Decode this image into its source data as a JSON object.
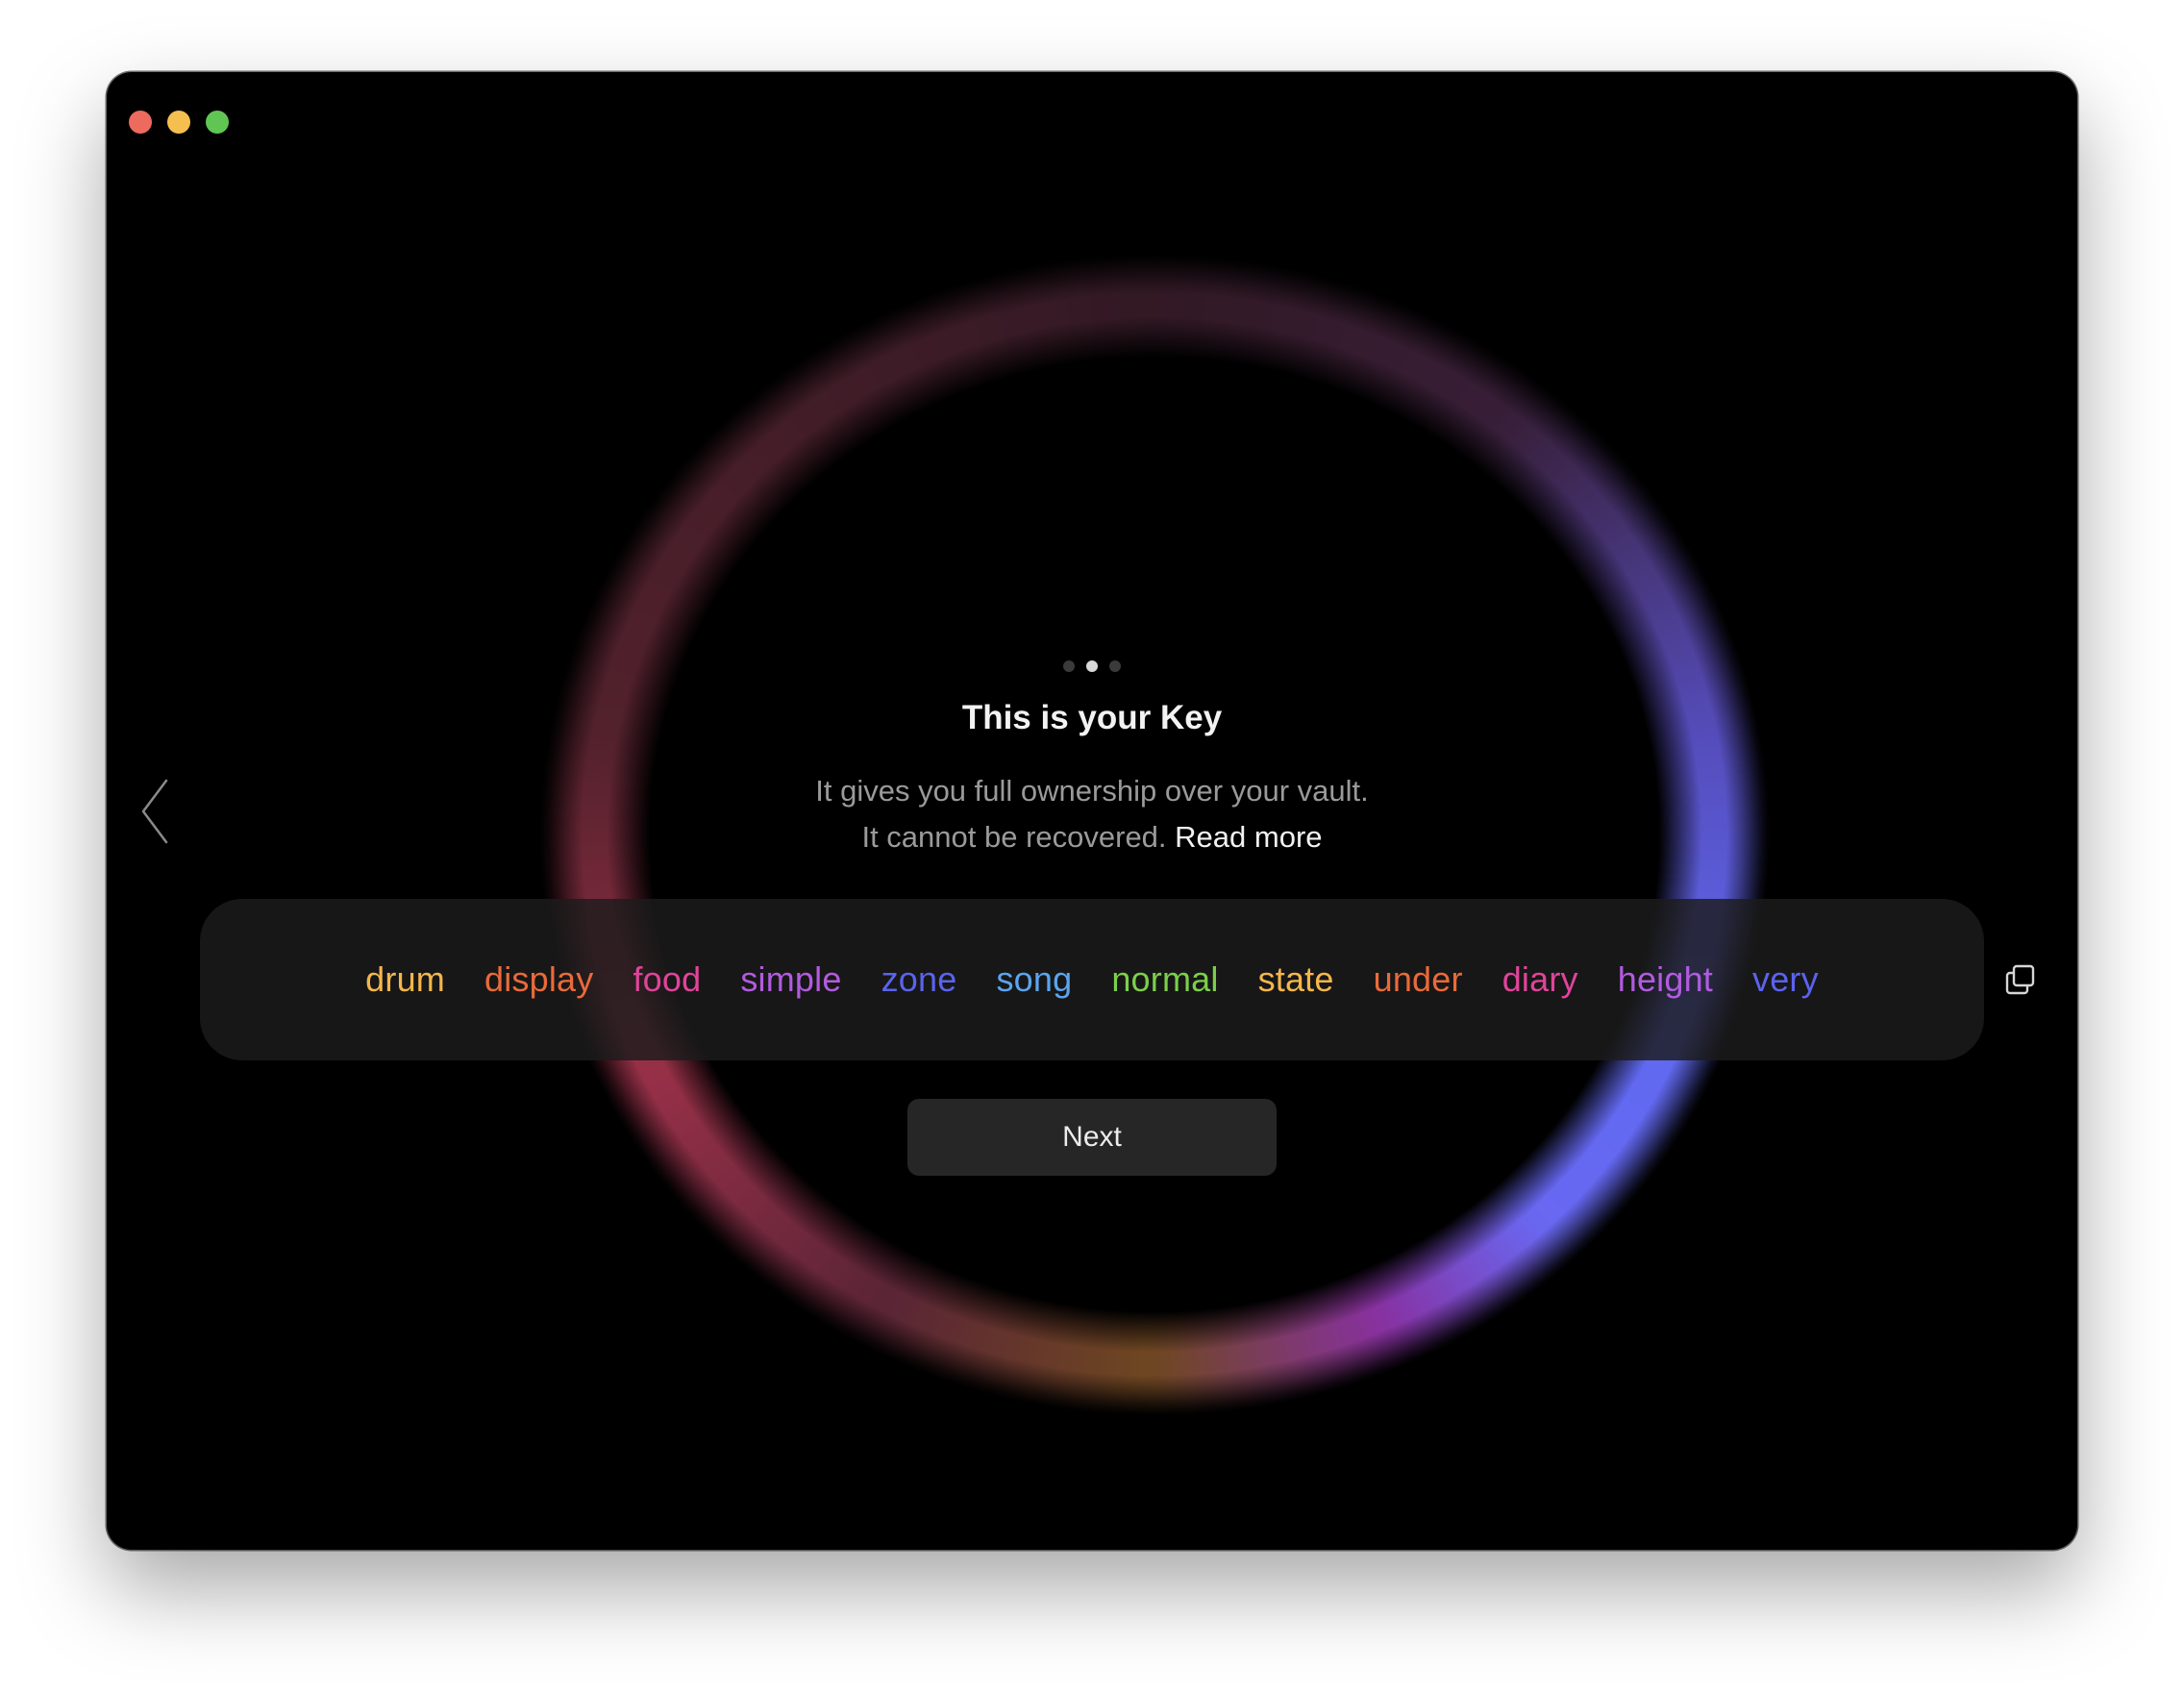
{
  "onboarding": {
    "title": "This is your Key",
    "line1": "It gives you full ownership over your vault.",
    "line2": "It cannot be recovered.",
    "read_more": "Read more",
    "page_indicator": {
      "total": 3,
      "current": 2
    },
    "next_label": "Next"
  },
  "icons": {
    "prev": "chevron-left-icon",
    "copy": "copy-icon"
  },
  "phrase": [
    {
      "word": "drum",
      "color": "#f5b64c"
    },
    {
      "word": "display",
      "color": "#ea6a3a"
    },
    {
      "word": "food",
      "color": "#e0449a"
    },
    {
      "word": "simple",
      "color": "#b25be0"
    },
    {
      "word": "zone",
      "color": "#5b63ee"
    },
    {
      "word": "song",
      "color": "#5aa5ef"
    },
    {
      "word": "normal",
      "color": "#7ccf4a"
    },
    {
      "word": "state",
      "color": "#f5b64c"
    },
    {
      "word": "under",
      "color": "#ea6a3a"
    },
    {
      "word": "diary",
      "color": "#e0449a"
    },
    {
      "word": "height",
      "color": "#b25be0"
    },
    {
      "word": "very",
      "color": "#5b63ee"
    }
  ]
}
